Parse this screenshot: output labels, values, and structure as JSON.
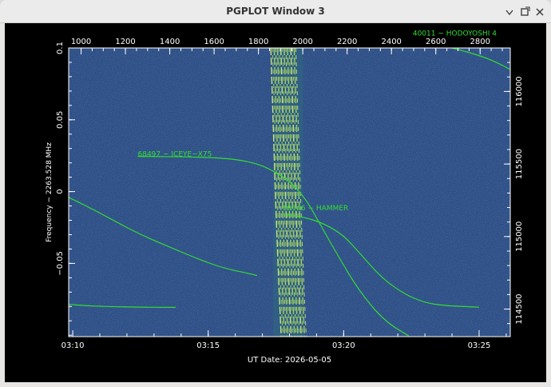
{
  "window": {
    "title": "PGPLOT Window 3",
    "buttons": {
      "minimize": "minimize-icon",
      "maximize": "maximize-icon",
      "close": "close-icon"
    }
  },
  "colors": {
    "background": "#000000",
    "axis_text": "#ffffff",
    "trace": "#32dd32",
    "waterfall_base": "#26437a"
  },
  "chart_data": {
    "type": "heatmap",
    "xlabel": "UT Date: 2026-05-05",
    "ylabel": "Frequency − 2263.528 MHz",
    "bottom_ticks": [
      "03:10",
      "03:15",
      "03:20",
      "03:25"
    ],
    "bottom_tick_minutes": [
      10,
      15,
      20,
      25
    ],
    "x_range_minutes": [
      9.85,
      26.15
    ],
    "top_ticks": [
      1000,
      1200,
      1400,
      1600,
      1800,
      2000,
      2200,
      2400,
      2600,
      2800
    ],
    "top_range": [
      944,
      2936
    ],
    "left_ticks": [
      "0.1",
      "0.05",
      "0",
      "−0.05"
    ],
    "left_tick_values": [
      0.1,
      0.05,
      0,
      -0.05
    ],
    "y_range": [
      -0.101,
      0.1
    ],
    "right_ticks": [
      "116000",
      "115500",
      "115000",
      "114500"
    ],
    "right_tick_values": [
      116000,
      115500,
      115000,
      114500
    ],
    "right_range": [
      114310,
      116300
    ],
    "labels": [
      {
        "text": "40011 − HODOYOSHI 4",
        "minute": 22.55,
        "freq": 0.1085
      },
      {
        "text": "68497 − ICEYE−X75",
        "minute": 12.4,
        "freq": 0.0245
      },
      {
        "text": "59146 − HAMMER",
        "minute": 17.75,
        "freq": -0.013
      }
    ],
    "series": [
      {
        "minutes": [
          9.85,
          10.5,
          11.5,
          12.5,
          13.5,
          14.5,
          15.5,
          16.5,
          16.8
        ],
        "freq": [
          -0.004,
          -0.01,
          -0.02,
          -0.03,
          -0.038,
          -0.046,
          -0.053,
          -0.057,
          -0.0585
        ]
      },
      {
        "minutes": [
          9.85,
          10.5,
          11.5,
          12.5,
          13.5,
          13.8
        ],
        "freq": [
          -0.0785,
          -0.0795,
          -0.0802,
          -0.0805,
          -0.0806,
          -0.0806
        ]
      },
      {
        "minutes": [
          12.4,
          14.0,
          15.3,
          16.1,
          16.8,
          17.4,
          18.0,
          18.6,
          19.2,
          19.8,
          20.6,
          21.5,
          22.4
        ],
        "freq": [
          0.0245,
          0.0243,
          0.0236,
          0.0222,
          0.0195,
          0.0145,
          0.0075,
          -0.005,
          -0.025,
          -0.045,
          -0.07,
          -0.09,
          -0.1005
        ]
      },
      {
        "minutes": [
          17.75,
          18.6,
          19.3,
          20.0,
          20.6,
          21.4,
          22.2,
          23.0,
          23.8,
          24.6,
          25.0
        ],
        "freq": [
          -0.0155,
          -0.018,
          -0.0225,
          -0.0305,
          -0.043,
          -0.06,
          -0.071,
          -0.0775,
          -0.0795,
          -0.0802,
          -0.0805
        ]
      },
      {
        "minutes": [
          24.0,
          24.6,
          25.2,
          25.7,
          26.15
        ],
        "freq": [
          0.1,
          0.097,
          0.0935,
          0.0895,
          0.085
        ]
      }
    ],
    "doppler_band": {
      "minute_start": 17.4,
      "minute_end": 18.5,
      "streaks": 16
    }
  }
}
